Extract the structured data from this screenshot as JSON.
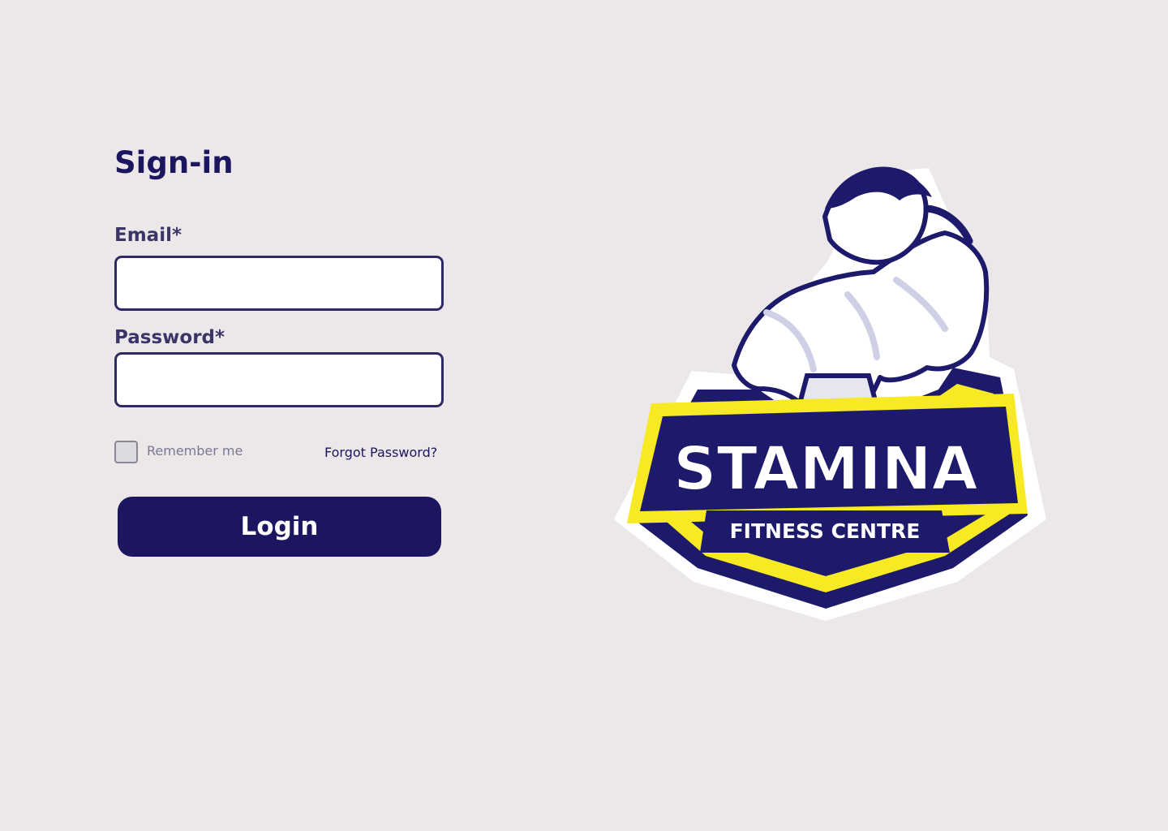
{
  "signin": {
    "title": "Sign-in",
    "email_label": "Email*",
    "email_value": "",
    "email_placeholder": "",
    "password_label": "Password*",
    "password_value": "",
    "password_placeholder": "",
    "remember_label": "Remember me",
    "remember_checked": false,
    "forgot_label": "Forgot Password?",
    "login_label": "Login"
  },
  "logo": {
    "title": "STAMINA",
    "subtitle": "FITNESS CENTRE",
    "icon": "bodybuilder-flexing-icon"
  },
  "colors": {
    "background": "#ece8e9",
    "primary": "#1c1560",
    "label": "#3a3566",
    "muted": "#7b7894",
    "logo_yellow": "#f7e923",
    "logo_navy": "#1e1a6b"
  }
}
